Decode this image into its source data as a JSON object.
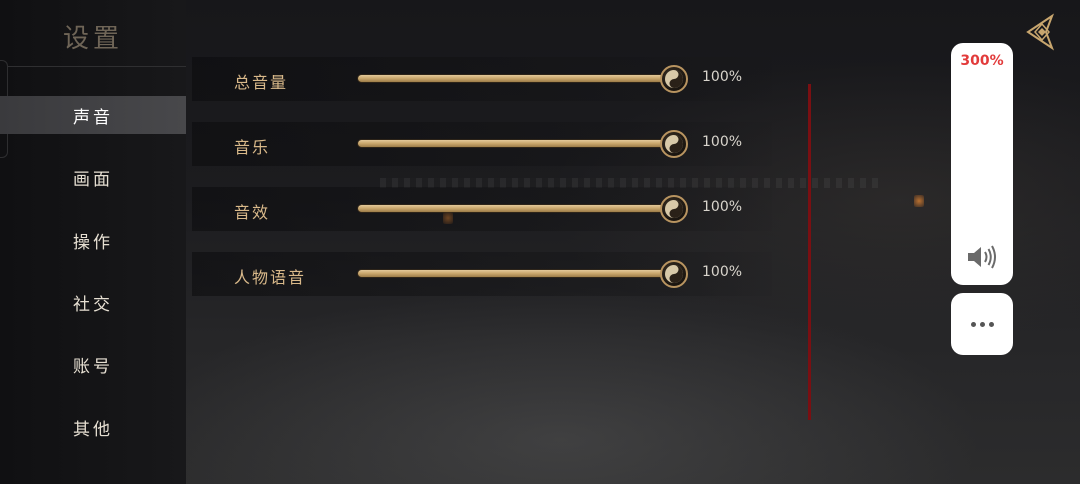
{
  "sidebar": {
    "title": "设置",
    "items": [
      {
        "label": "声音",
        "active": true
      },
      {
        "label": "画面",
        "active": false
      },
      {
        "label": "操作",
        "active": false
      },
      {
        "label": "社交",
        "active": false
      },
      {
        "label": "账号",
        "active": false
      },
      {
        "label": "其他",
        "active": false
      }
    ]
  },
  "sound_settings": [
    {
      "label": "总音量",
      "value": 100,
      "value_text": "100%"
    },
    {
      "label": "音乐",
      "value": 100,
      "value_text": "100%"
    },
    {
      "label": "音效",
      "value": 100,
      "value_text": "100%"
    },
    {
      "label": "人物语音",
      "value": 100,
      "value_text": "100%"
    }
  ],
  "system_volume": {
    "percent_text": "300%",
    "icon": "speaker-icon",
    "more_icon": "more-dots-icon"
  },
  "icons": {
    "back": "back-diamond-icon",
    "knob": "yin-yang-knob-icon"
  },
  "colors": {
    "accent_gold": "#d9b98a",
    "scroll_red": "#7a0f12",
    "volume_red": "#e23b3b"
  }
}
